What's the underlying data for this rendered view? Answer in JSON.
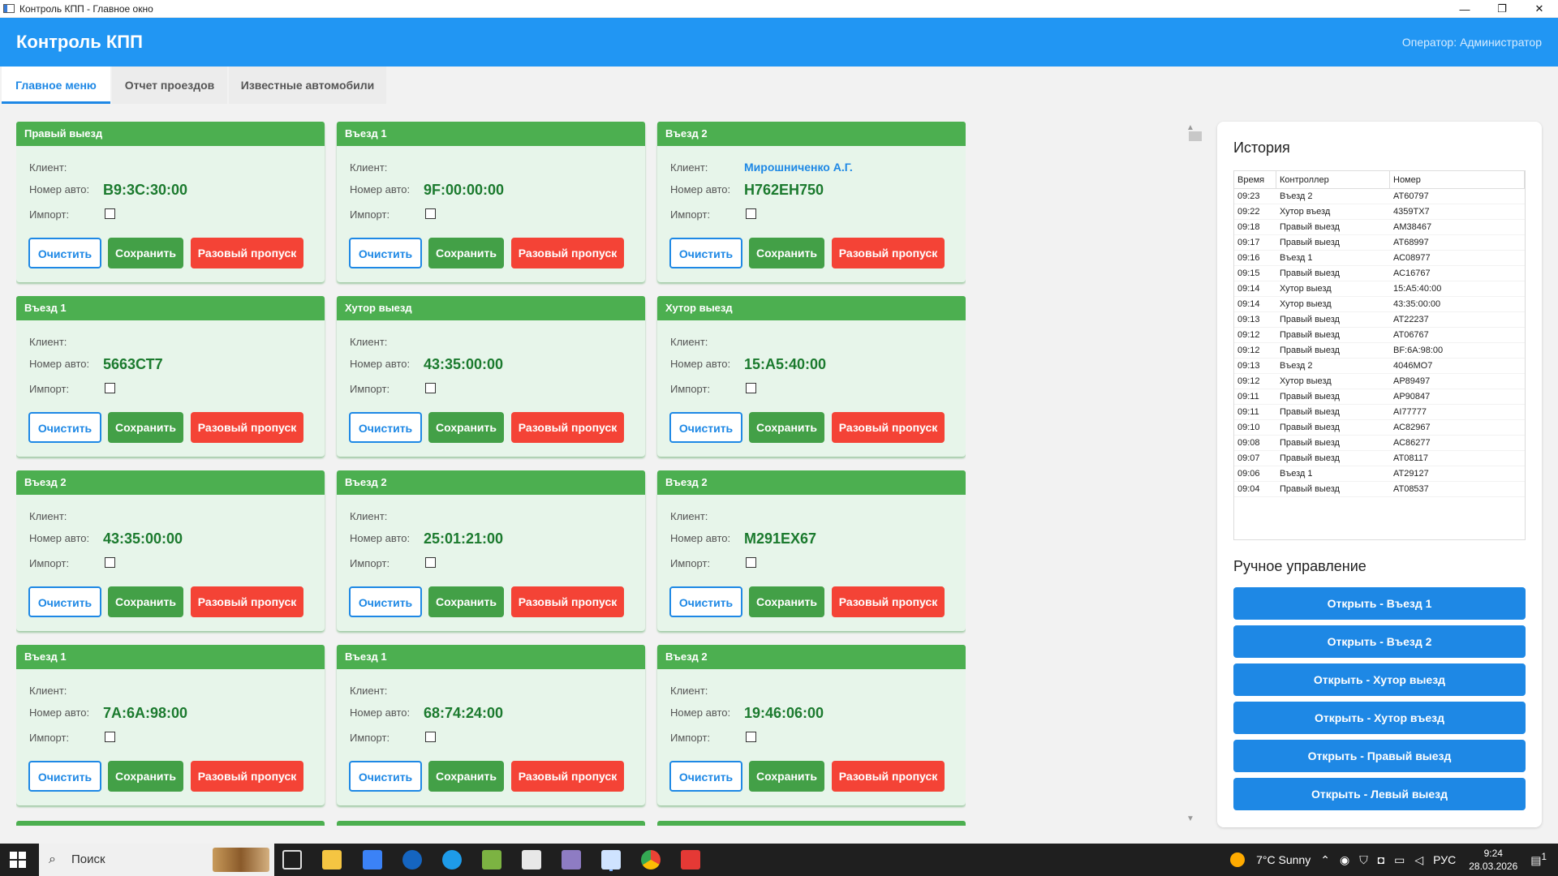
{
  "window": {
    "title": "Контроль КПП - Главное окно",
    "controls": [
      "—",
      "❐",
      "✕"
    ]
  },
  "header": {
    "title": "Контроль КПП",
    "operator": "Оператор: Администратор"
  },
  "tabs": [
    "Главное меню",
    "Отчет проездов",
    "Известные автомобили"
  ],
  "card_labels": {
    "client": "Клиент:",
    "plate": "Номер авто:",
    "import": "Импорт:",
    "clear": "Очистить",
    "save": "Сохранить",
    "pass": "Разовый пропуск"
  },
  "cards": [
    {
      "title": "Правый выезд",
      "client": "",
      "plate": "B9:3C:30:00"
    },
    {
      "title": "Въезд 1",
      "client": "",
      "plate": "9F:00:00:00"
    },
    {
      "title": "Въезд 2",
      "client": "Мирошниченко А.Г.",
      "plate": "Н762ЕН750"
    },
    {
      "title": "Въезд 1",
      "client": "",
      "plate": "5663СТ7"
    },
    {
      "title": "Хутор выезд",
      "client": "",
      "plate": "43:35:00:00"
    },
    {
      "title": "Хутор выезд",
      "client": "",
      "plate": "15:A5:40:00"
    },
    {
      "title": "Въезд 2",
      "client": "",
      "plate": "43:35:00:00"
    },
    {
      "title": "Въезд 2",
      "client": "",
      "plate": "25:01:21:00"
    },
    {
      "title": "Въезд 2",
      "client": "",
      "plate": "М291ЕХ67"
    },
    {
      "title": "Въезд 1",
      "client": "",
      "plate": "7A:6A:98:00"
    },
    {
      "title": "Въезд 1",
      "client": "",
      "plate": "68:74:24:00"
    },
    {
      "title": "Въезд 2",
      "client": "",
      "plate": "19:46:06:00"
    }
  ],
  "history": {
    "title": "История",
    "columns": [
      "Время",
      "Контроллер",
      "Номер"
    ],
    "rows": [
      [
        "09:23",
        "Въезд 2",
        "АТ60797"
      ],
      [
        "09:22",
        "Хутор въезд",
        "4359ТХ7"
      ],
      [
        "09:18",
        "Правый выезд",
        "АМ38467"
      ],
      [
        "09:17",
        "Правый выезд",
        "АТ68997"
      ],
      [
        "09:16",
        "Въезд 1",
        "АС08977"
      ],
      [
        "09:15",
        "Правый выезд",
        "АС16767"
      ],
      [
        "09:14",
        "Хутор выезд",
        "15:A5:40:00"
      ],
      [
        "09:14",
        "Хутор выезд",
        "43:35:00:00"
      ],
      [
        "09:13",
        "Правый выезд",
        "АТ22237"
      ],
      [
        "09:12",
        "Правый выезд",
        "АТ06767"
      ],
      [
        "09:12",
        "Правый выезд",
        "BF:6A:98:00"
      ],
      [
        "09:13",
        "Въезд 2",
        "4046МО7"
      ],
      [
        "09:12",
        "Хутор выезд",
        "АР89497"
      ],
      [
        "09:11",
        "Правый выезд",
        "АР90847"
      ],
      [
        "09:11",
        "Правый выезд",
        "АІ77777"
      ],
      [
        "09:10",
        "Правый выезд",
        "АС82967"
      ],
      [
        "09:08",
        "Правый выезд",
        "АС86277"
      ],
      [
        "09:07",
        "Правый выезд",
        "АТ08117"
      ],
      [
        "09:06",
        "Въезд 1",
        "АТ29127"
      ],
      [
        "09:04",
        "Правый выезд",
        "АТ08537"
      ]
    ]
  },
  "manual": {
    "title": "Ручное управление",
    "buttons": [
      "Открыть - Въезд 1",
      "Открыть - Въезд 2",
      "Открыть - Хутор выезд",
      "Открыть - Хутор въезд",
      "Открыть - Правый выезд",
      "Открыть - Левый выезд"
    ]
  },
  "taskbar": {
    "search": "Поиск",
    "weather": "7°C  Sunny",
    "lang": "РУС",
    "time": "9:24",
    "date": "28.03.2026",
    "notif": "1"
  },
  "colors": {
    "header": "#2196f3",
    "card_header": "#4caf50",
    "card_bg": "#e7f5ea",
    "pass_button": "#f44336",
    "manual_button": "#1e88e5"
  }
}
